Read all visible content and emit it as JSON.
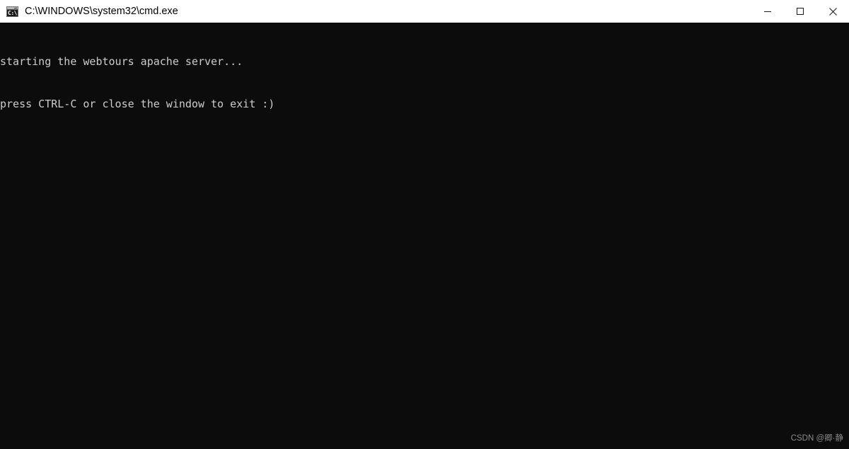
{
  "window": {
    "title": "C:\\WINDOWS\\system32\\cmd.exe",
    "icon_label": "C:\\",
    "background_color": "#0c0c0c",
    "titlebar_color": "#ffffff",
    "text_color": "#cccccc"
  },
  "controls": {
    "minimize_label": "Minimize",
    "maximize_label": "Maximize",
    "close_label": "Close"
  },
  "console": {
    "lines": [
      "starting the webtours apache server...",
      "press CTRL-C or close the window to exit :)"
    ],
    "line1": "starting the webtours apache server...",
    "line2": "press CTRL-C or close the window to exit :)"
  },
  "watermark": {
    "text": "CSDN @卿·静"
  }
}
